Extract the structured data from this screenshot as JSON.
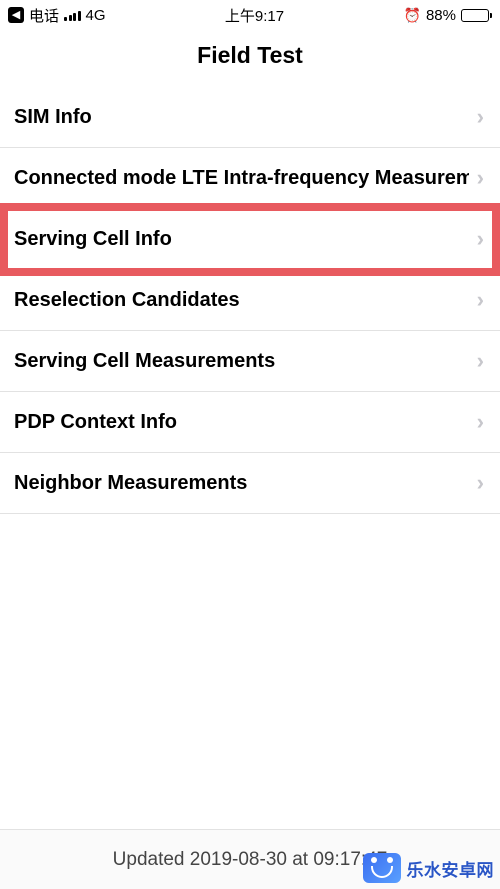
{
  "status": {
    "carrier": "电话",
    "network": "4G",
    "time": "上午9:17",
    "battery_pct": "88%"
  },
  "nav": {
    "title": "Field Test"
  },
  "rows": {
    "r0": "SIM Info",
    "r1": "Connected mode LTE Intra-frequency Measurement",
    "r2": "Serving Cell Info",
    "r3": "Reselection Candidates",
    "r4": "Serving Cell Measurements",
    "r5": "PDP Context Info",
    "r6": "Neighbor Measurements"
  },
  "footer": {
    "updated": "Updated 2019-08-30 at 09:17:47"
  },
  "watermark": {
    "text": "乐水安卓网"
  }
}
